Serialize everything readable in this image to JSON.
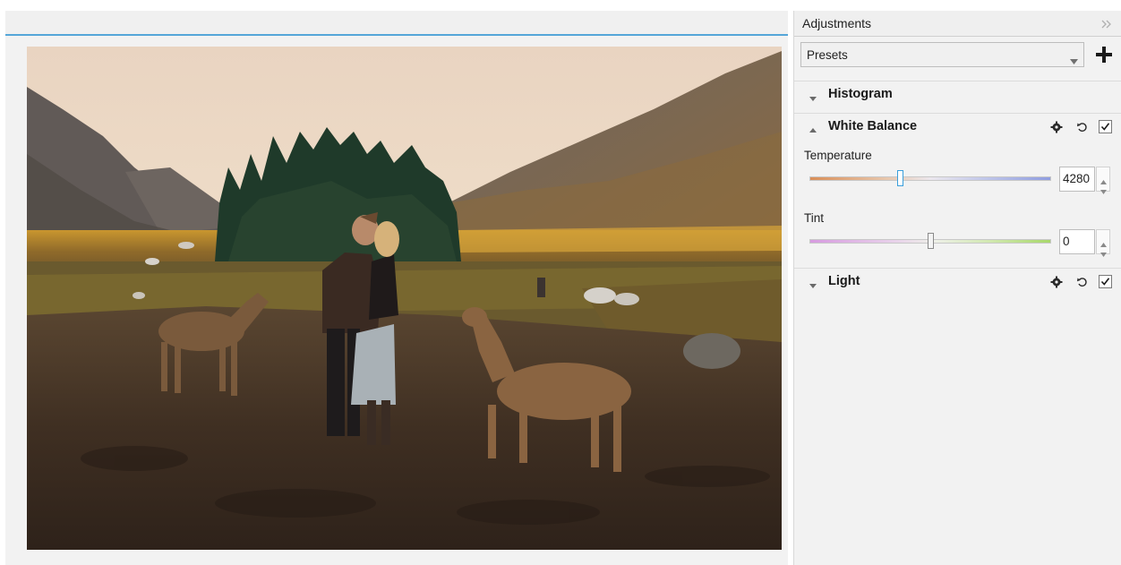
{
  "panel": {
    "title": "Adjustments",
    "presets": {
      "value": "Presets"
    },
    "sections": {
      "histogram": {
        "title": "Histogram",
        "expanded": false
      },
      "white_balance": {
        "title": "White Balance",
        "expanded": true,
        "enabled": true,
        "temperature": {
          "label": "Temperature",
          "value": "4280"
        },
        "tint": {
          "label": "Tint",
          "value": "0"
        }
      },
      "light": {
        "title": "Light",
        "expanded": false,
        "enabled": true
      }
    }
  },
  "icons": {
    "collapse": "double-chevron-right-icon",
    "add": "plus-icon",
    "settings": "gear-icon",
    "reset": "reset-icon",
    "enabled": "checkbox-checked-icon"
  },
  "colors": {
    "accent": "#55a6d8",
    "panel_bg": "#f2f2f2"
  }
}
